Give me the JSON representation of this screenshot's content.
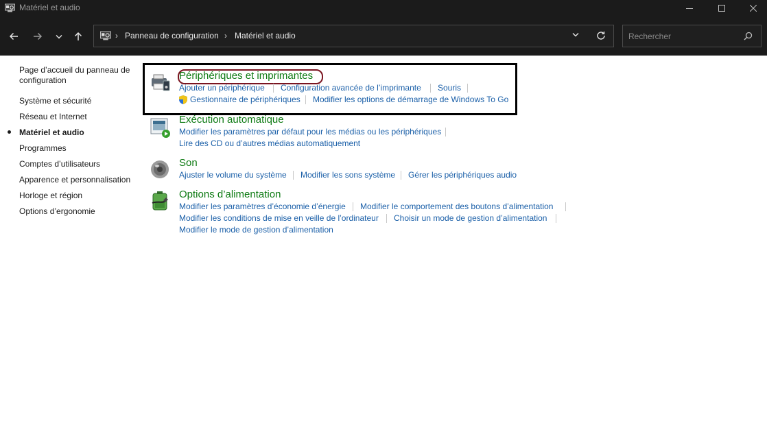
{
  "window": {
    "title": "Matériel et audio",
    "icon": "control-panel-icon",
    "controls": [
      "minimize-icon",
      "maximize-icon",
      "close-icon"
    ]
  },
  "navigation": {
    "back_icon": "arrow-left-icon",
    "forward_icon": "arrow-right-icon",
    "recent_icon": "chevron-down-icon",
    "up_icon": "arrow-up-icon"
  },
  "address": {
    "crumbs": [
      "Panneau de configuration",
      "Matériel et audio"
    ],
    "separator": "›"
  },
  "search": {
    "placeholder": "Rechercher"
  },
  "sidebar": {
    "items": [
      {
        "label": "Page d’accueil du panneau de configuration"
      },
      {
        "label": "Système et sécurité"
      },
      {
        "label": "Réseau et Internet"
      },
      {
        "label": "Matériel et audio",
        "active": true
      },
      {
        "label": "Programmes"
      },
      {
        "label": "Comptes d’utilisateurs"
      },
      {
        "label": "Apparence et personnalisation"
      },
      {
        "label": "Horloge et région"
      },
      {
        "label": "Options d’ergonomie"
      }
    ],
    "home_line1": "Page d’accueil du panneau de",
    "home_line2": "configuration"
  },
  "groups": {
    "devices": {
      "title": "Périphériques et imprimantes",
      "icon": "printer-icon",
      "links": [
        "Ajouter un périphérique",
        "Configuration avancée de l’imprimante",
        "Souris",
        "Gestionnaire de périphériques",
        "Modifier les options de démarrage de Windows To Go"
      ]
    },
    "autoplay": {
      "title": "Exécution automatique",
      "icon": "autoplay-icon",
      "links": [
        "Modifier les paramètres par défaut pour les médias ou les périphériques",
        "Lire des CD ou d’autres médias automatiquement"
      ]
    },
    "sound": {
      "title": "Son",
      "icon": "speaker-icon",
      "links": [
        "Ajuster le volume du système",
        "Modifier les sons système",
        "Gérer les périphériques audio"
      ]
    },
    "power": {
      "title": "Options d’alimentation",
      "icon": "battery-icon",
      "links": [
        "Modifier les paramètres d’économie d’énergie",
        "Modifier le comportement des boutons d’alimentation",
        "Modifier les conditions de mise en veille de l’ordinateur",
        "Choisir un mode de gestion d’alimentation",
        "Modifier le mode de gestion d’alimentation"
      ]
    }
  },
  "colors": {
    "heading": "#0d7a12",
    "link": "#1a5fa8",
    "chrome": "#1b1b1b",
    "highlight_box": "#000000",
    "highlight_oval": "#7a1420"
  }
}
